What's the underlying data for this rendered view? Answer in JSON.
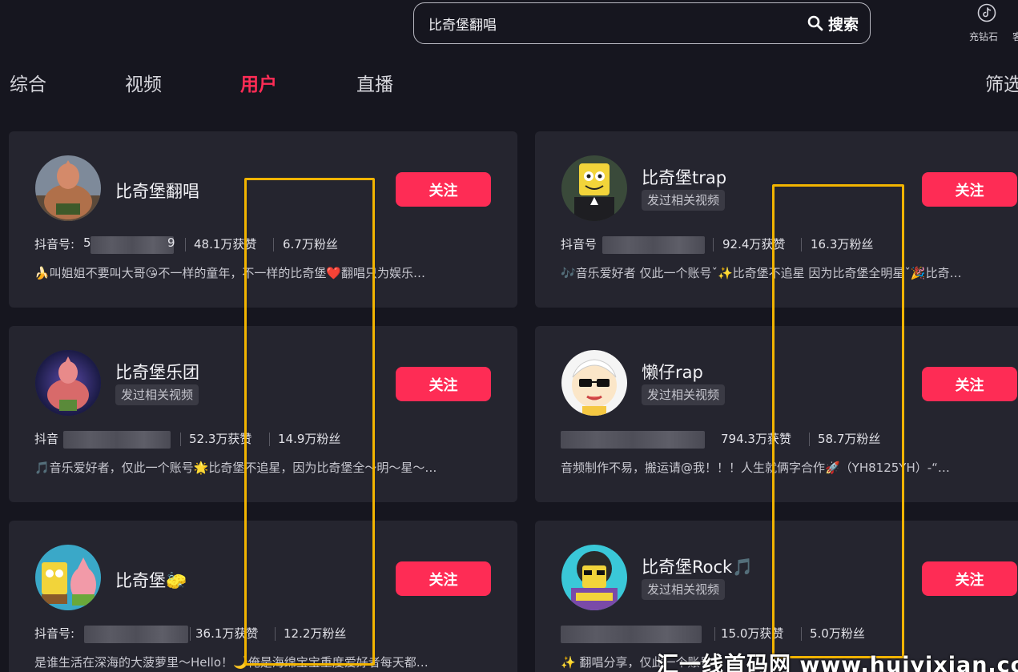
{
  "search": {
    "value": "比奇堡翻唱",
    "button_label": "搜索"
  },
  "top_right": {
    "label": "充钻石",
    "label_2": "客"
  },
  "tabs": [
    {
      "label": "综合"
    },
    {
      "label": "视频"
    },
    {
      "label": "用户"
    },
    {
      "label": "直播"
    }
  ],
  "active_tab": "用户",
  "filter_label": "筛选",
  "follow_label": "关注",
  "cards": [
    {
      "name": "比奇堡翻唱",
      "tag": "",
      "id_label": "抖音号: ",
      "id_prefix": "5",
      "id_suffix": "9",
      "likes": "48.1万获赞",
      "fans": "6.7万粉丝",
      "bio": "🍌叫姐姐不要叫大哥😘不一样的童年，不一样的比奇堡❤️翻唱只为娱乐…"
    },
    {
      "name": "比奇堡trap",
      "tag": "发过相关视频",
      "id_label": "抖音号",
      "id_prefix": "",
      "id_suffix": "",
      "likes": "92.4万获赞",
      "fans": "16.3万粉丝",
      "bio": "🎶音乐爱好者 仅此一个账号ˇ✨比奇堡不追星 因为比奇堡全明星ˇ🎉比奇…"
    },
    {
      "name": "比奇堡乐团",
      "tag": "发过相关视频",
      "id_label": "抖音",
      "id_prefix": "",
      "id_suffix": "",
      "likes": "52.3万获赞",
      "fans": "14.9万粉丝",
      "bio": "🎵音乐爱好者，仅此一个账号🌟比奇堡不追星，因为比奇堡全～明～星～…"
    },
    {
      "name": "懒仔rap",
      "tag": "发过相关视频",
      "id_label": "",
      "id_prefix": "",
      "id_suffix": "",
      "likes": "794.3万获赞",
      "fans": "58.7万粉丝",
      "bio": "音频制作不易，搬运请@我！！！人生就俩字合作🚀（YH8125YH）-“…"
    },
    {
      "name": "比奇堡🧽",
      "tag": "",
      "id_label": "抖音号: ",
      "id_prefix": "",
      "id_suffix": "",
      "likes": "36.1万获赞",
      "fans": "12.2万粉丝",
      "bio": "是谁生活在深海的大菠萝里～Hello！🌙俺是海绵宝宝重度爱好者每天都…"
    },
    {
      "name": "比奇堡Rock🎵",
      "tag": "发过相关视频",
      "id_label": "",
      "id_prefix": "",
      "id_suffix": "",
      "likes": "15.0万获赞",
      "fans": "5.0万粉丝",
      "bio": "✨ 翻唱分享，仅此一个账号…"
    }
  ],
  "watermark": "汇一线首码网 www.huiyixian.com",
  "colors": {
    "accent": "#fe2c55",
    "highlight": "#f2b400",
    "background": "#16161f",
    "card": "#25252f"
  }
}
